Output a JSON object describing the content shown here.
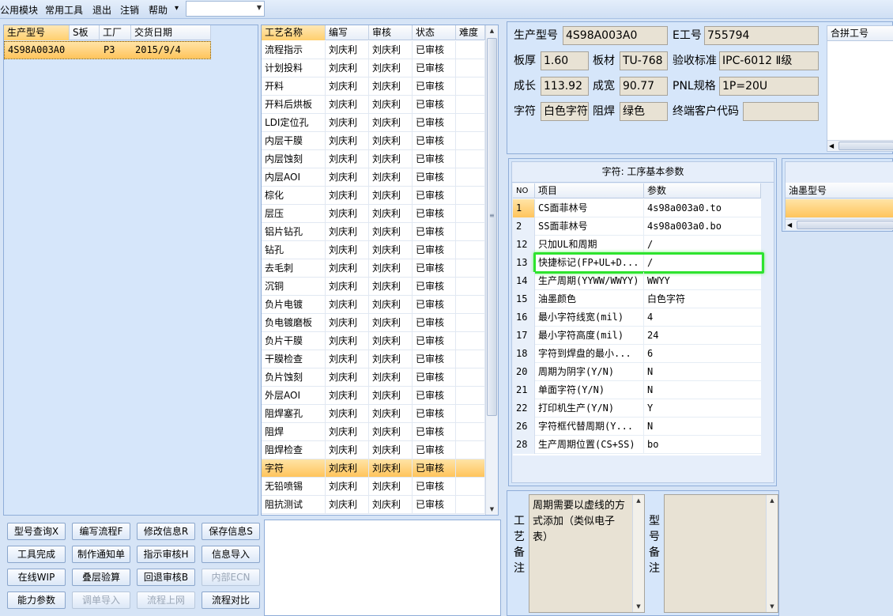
{
  "menu": {
    "items": [
      "公用模块",
      "常用工具",
      "退出",
      "注销",
      "帮助"
    ],
    "more_arrow": "▾",
    "combo_value": ""
  },
  "orders": {
    "headers": [
      "生产型号",
      "S板",
      "工厂",
      "交货日期"
    ],
    "rows": [
      {
        "model": "4S98A003A0",
        "s": "",
        "factory": "P3",
        "date": "2015/9/4"
      }
    ]
  },
  "process": {
    "headers": [
      "工艺名称",
      "编写",
      "审核",
      "状态",
      "难度"
    ],
    "rows": [
      {
        "name": "流程指示",
        "writer": "刘庆利",
        "reviewer": "刘庆利",
        "status": "已审核",
        "diff": ""
      },
      {
        "name": "计划投料",
        "writer": "刘庆利",
        "reviewer": "刘庆利",
        "status": "已审核",
        "diff": ""
      },
      {
        "name": "开料",
        "writer": "刘庆利",
        "reviewer": "刘庆利",
        "status": "已审核",
        "diff": ""
      },
      {
        "name": "开料后烘板",
        "writer": "刘庆利",
        "reviewer": "刘庆利",
        "status": "已审核",
        "diff": ""
      },
      {
        "name": "LDI定位孔",
        "writer": "刘庆利",
        "reviewer": "刘庆利",
        "status": "已审核",
        "diff": ""
      },
      {
        "name": "内层干膜",
        "writer": "刘庆利",
        "reviewer": "刘庆利",
        "status": "已审核",
        "diff": ""
      },
      {
        "name": "内层蚀刻",
        "writer": "刘庆利",
        "reviewer": "刘庆利",
        "status": "已审核",
        "diff": ""
      },
      {
        "name": "内层AOI",
        "writer": "刘庆利",
        "reviewer": "刘庆利",
        "status": "已审核",
        "diff": ""
      },
      {
        "name": "棕化",
        "writer": "刘庆利",
        "reviewer": "刘庆利",
        "status": "已审核",
        "diff": ""
      },
      {
        "name": "层压",
        "writer": "刘庆利",
        "reviewer": "刘庆利",
        "status": "已审核",
        "diff": ""
      },
      {
        "name": "铝片钻孔",
        "writer": "刘庆利",
        "reviewer": "刘庆利",
        "status": "已审核",
        "diff": ""
      },
      {
        "name": "钻孔",
        "writer": "刘庆利",
        "reviewer": "刘庆利",
        "status": "已审核",
        "diff": ""
      },
      {
        "name": "去毛刺",
        "writer": "刘庆利",
        "reviewer": "刘庆利",
        "status": "已审核",
        "diff": ""
      },
      {
        "name": "沉铜",
        "writer": "刘庆利",
        "reviewer": "刘庆利",
        "status": "已审核",
        "diff": ""
      },
      {
        "name": "负片电镀",
        "writer": "刘庆利",
        "reviewer": "刘庆利",
        "status": "已审核",
        "diff": ""
      },
      {
        "name": "负电镀磨板",
        "writer": "刘庆利",
        "reviewer": "刘庆利",
        "status": "已审核",
        "diff": ""
      },
      {
        "name": "负片干膜",
        "writer": "刘庆利",
        "reviewer": "刘庆利",
        "status": "已审核",
        "diff": ""
      },
      {
        "name": "干膜检查",
        "writer": "刘庆利",
        "reviewer": "刘庆利",
        "status": "已审核",
        "diff": ""
      },
      {
        "name": "负片蚀刻",
        "writer": "刘庆利",
        "reviewer": "刘庆利",
        "status": "已审核",
        "diff": ""
      },
      {
        "name": "外层AOI",
        "writer": "刘庆利",
        "reviewer": "刘庆利",
        "status": "已审核",
        "diff": ""
      },
      {
        "name": "阻焊塞孔",
        "writer": "刘庆利",
        "reviewer": "刘庆利",
        "status": "已审核",
        "diff": ""
      },
      {
        "name": "阻焊",
        "writer": "刘庆利",
        "reviewer": "刘庆利",
        "status": "已审核",
        "diff": ""
      },
      {
        "name": "阻焊检查",
        "writer": "刘庆利",
        "reviewer": "刘庆利",
        "status": "已审核",
        "diff": ""
      },
      {
        "name": "字符",
        "writer": "刘庆利",
        "reviewer": "刘庆利",
        "status": "已审核",
        "diff": ""
      },
      {
        "name": "无铅喷锡",
        "writer": "刘庆利",
        "reviewer": "刘庆利",
        "status": "已审核",
        "diff": ""
      },
      {
        "name": "阻抗测试",
        "writer": "刘庆利",
        "reviewer": "刘庆利",
        "status": "已审核",
        "diff": ""
      }
    ],
    "selected_index": 23
  },
  "buttons": [
    [
      "型号查询X",
      "编写流程F",
      "修改信息R",
      "保存信息S"
    ],
    [
      "工具完成",
      "制作通知单",
      "指示审核H",
      "信息导入"
    ],
    [
      "在线WIP",
      "叠层验算",
      "回退审核B",
      "内部ECN"
    ],
    [
      "能力参数",
      "调单导入",
      "流程上网",
      "流程对比"
    ]
  ],
  "disabled_buttons": [
    "内部ECN",
    "调单导入",
    "流程上网"
  ],
  "info": {
    "model_label": "生产型号",
    "model_value": "4S98A003A0",
    "eid_label": "E工号",
    "eid_value": "755794",
    "thickness_label": "板厚",
    "thickness_value": "1.60",
    "material_label": "板材",
    "material_value": "TU-768",
    "standard_label": "验收标准",
    "standard_value": "IPC-6012 Ⅱ级",
    "length_label": "成长",
    "length_value": "113.92",
    "width_label": "成宽",
    "width_value": "90.77",
    "pnl_label": "PNL规格",
    "pnl_value": "1P=20U",
    "char_label": "字符",
    "char_value": "白色字符",
    "mask_label": "阻焊",
    "mask_value": "绿色",
    "customer_label": "终端客户代码",
    "customer_value": "",
    "merge_header": "合拼工号"
  },
  "params": {
    "title": "字符: 工序基本参数",
    "headers": [
      "NO",
      "项目",
      "参数"
    ],
    "rows": [
      {
        "no": "1",
        "item": "CS面菲林号",
        "value": "4s98a003a0.to"
      },
      {
        "no": "2",
        "item": "SS面菲林号",
        "value": "4s98a003a0.bo"
      },
      {
        "no": "12",
        "item": "只加UL和周期",
        "value": "/"
      },
      {
        "no": "13",
        "item": "快捷标记(FP+UL+D...",
        "value": "/"
      },
      {
        "no": "14",
        "item": "生产周期(YYWW/WWYY)",
        "value": "WWYY"
      },
      {
        "no": "15",
        "item": "油墨颜色",
        "value": "白色字符"
      },
      {
        "no": "16",
        "item": "最小字符线宽(mil)",
        "value": "4"
      },
      {
        "no": "17",
        "item": "最小字符高度(mil)",
        "value": "24"
      },
      {
        "no": "18",
        "item": "字符到焊盘的最小...",
        "value": "6"
      },
      {
        "no": "20",
        "item": "周期为阴字(Y/N)",
        "value": "N"
      },
      {
        "no": "21",
        "item": "单面字符(Y/N)",
        "value": "N"
      },
      {
        "no": "22",
        "item": "打印机生产(Y/N)",
        "value": "Y"
      },
      {
        "no": "26",
        "item": "字符框代替周期(Y...",
        "value": "N"
      },
      {
        "no": "28",
        "item": "生产周期位置(CS+SS)",
        "value": "bo"
      }
    ],
    "selected_index": 0,
    "highlight_index": 3
  },
  "ink": {
    "header": "油墨型号"
  },
  "remarks": {
    "process_label": [
      "工",
      "艺",
      "备",
      "注"
    ],
    "process_text": "周期需要以虚线的方式添加（类似电子表）",
    "model_label": [
      "型",
      "号",
      "备",
      "注"
    ],
    "model_text": ""
  },
  "colors": {
    "selection": "#ffc45c",
    "highlight": "#2ee32e"
  }
}
